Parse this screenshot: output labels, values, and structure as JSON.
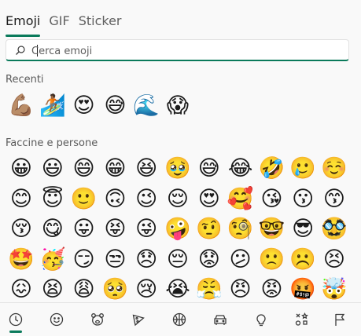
{
  "tabs": [
    {
      "label": "Emoji",
      "active": true
    },
    {
      "label": "GIF",
      "active": false
    },
    {
      "label": "Sticker",
      "active": false
    }
  ],
  "search": {
    "placeholder": "Cerca emoji",
    "value": ""
  },
  "sections": {
    "recent": {
      "title": "Recenti",
      "emojis": [
        "💪🏽",
        "🏄🏾",
        "😍",
        "😅",
        "🌊",
        "😱"
      ]
    },
    "faces": {
      "title": "Faccine e persone",
      "emojis": [
        "😀",
        "😃",
        "😄",
        "😁",
        "😆",
        "🥹",
        "😅",
        "😂",
        "🤣",
        "🥲",
        "☺️",
        "😊",
        "😇",
        "🙂",
        "🙃",
        "😉",
        "😌",
        "😍",
        "🥰",
        "😘",
        "😗",
        "😙",
        "😚",
        "😋",
        "😛",
        "😝",
        "😜",
        "🤪",
        "🤨",
        "🧐",
        "🤓",
        "😎",
        "🥸",
        "🤩",
        "🥳",
        "😏",
        "😒",
        "😞",
        "😔",
        "😟",
        "😕",
        "🙁",
        "☹️",
        "😣",
        "😖",
        "😫",
        "😩",
        "🥺",
        "😢",
        "😭",
        "😤",
        "😠",
        "😡",
        "🤬",
        "🤯"
      ]
    }
  },
  "categories": [
    {
      "name": "recent",
      "icon": "clock-icon",
      "active": true
    },
    {
      "name": "smileys",
      "icon": "smiley-icon",
      "active": false
    },
    {
      "name": "animals",
      "icon": "bear-icon",
      "active": false
    },
    {
      "name": "food",
      "icon": "pizza-icon",
      "active": false
    },
    {
      "name": "activities",
      "icon": "ball-icon",
      "active": false
    },
    {
      "name": "travel",
      "icon": "car-icon",
      "active": false
    },
    {
      "name": "objects",
      "icon": "lightbulb-icon",
      "active": false
    },
    {
      "name": "symbols",
      "icon": "symbols-icon",
      "active": false
    },
    {
      "name": "flags",
      "icon": "flag-icon",
      "active": false
    }
  ],
  "colors": {
    "accent": "#0a7a5b",
    "background": "#f9f9f9"
  }
}
